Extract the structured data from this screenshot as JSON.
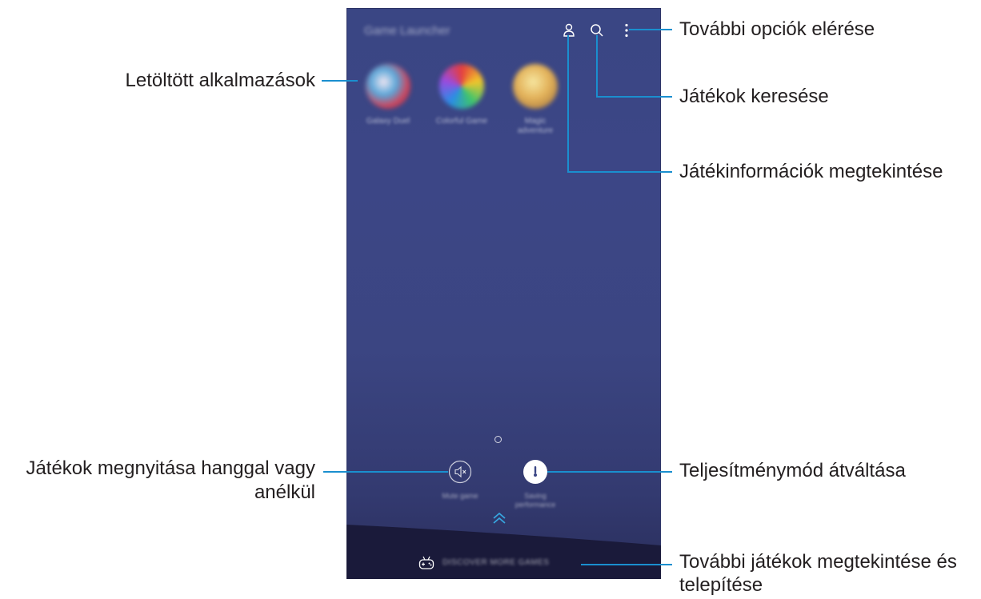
{
  "callouts": {
    "more_options": "További opciók elérése",
    "search_games": "Játékok keresése",
    "game_info": "Játékinformációk megtekintése",
    "downloaded_apps": "Letöltött alkalmazások",
    "sound_line1": "Játékok megnyitása hanggal vagy",
    "sound_line2": "anélkül",
    "performance_mode": "Teljesítménymód átváltása",
    "discover_line1": "További játékok megtekintése és",
    "discover_line2": "telepítése"
  },
  "screen": {
    "title": "Game Launcher",
    "apps": [
      {
        "label": "Galaxy Duel"
      },
      {
        "label": "Colorful Game"
      },
      {
        "label": "Magic\nadventure"
      }
    ],
    "mute_label": "Mute game",
    "performance_label": "Saving\nperformance",
    "discover_label": "DISCOVER MORE GAMES"
  },
  "icons": {
    "profile": "profile-icon",
    "search": "search-icon",
    "more": "more-options-icon",
    "mute": "mute-icon",
    "performance": "performance-icon",
    "chevron": "chevron-up-icon",
    "gamepad": "gamepad-icon"
  },
  "colors": {
    "callout_line": "#1a8fcf",
    "screen_bg": "#3b4583",
    "callout_text": "#231f20"
  }
}
